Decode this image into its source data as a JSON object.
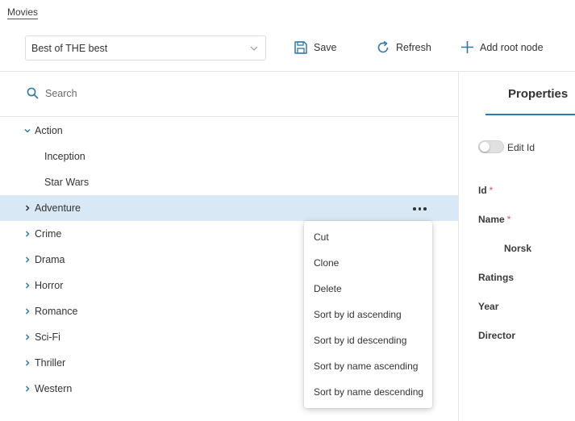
{
  "breadcrumb": "Movies",
  "toolbar": {
    "selected_view": "Best of THE best",
    "save_label": "Save",
    "refresh_label": "Refresh",
    "add_root_label": "Add root node"
  },
  "search": {
    "placeholder": "Search"
  },
  "tree": {
    "nodes": [
      {
        "label": "Action",
        "expanded": true
      },
      {
        "label": "Inception"
      },
      {
        "label": "Star Wars"
      },
      {
        "label": "Adventure",
        "selected": true
      },
      {
        "label": "Crime"
      },
      {
        "label": "Drama"
      },
      {
        "label": "Horror"
      },
      {
        "label": "Romance"
      },
      {
        "label": "Sci-Fi"
      },
      {
        "label": "Thriller"
      },
      {
        "label": "Western"
      }
    ]
  },
  "context_menu": {
    "items": [
      "Cut",
      "Clone",
      "Delete",
      "Sort by id ascending",
      "Sort by id descending",
      "Sort by name ascending",
      "Sort by name descending"
    ]
  },
  "properties": {
    "tab_label": "Properties",
    "edit_id_label": "Edit Id",
    "fields": {
      "id": "Id",
      "name": "Name",
      "name_sub": "Norsk",
      "ratings": "Ratings",
      "year": "Year",
      "director": "Director"
    },
    "required_marker": "*"
  },
  "colors": {
    "accent": "#2b7aaa",
    "selected_row": "#d8e8f5",
    "required": "#d9534f"
  }
}
